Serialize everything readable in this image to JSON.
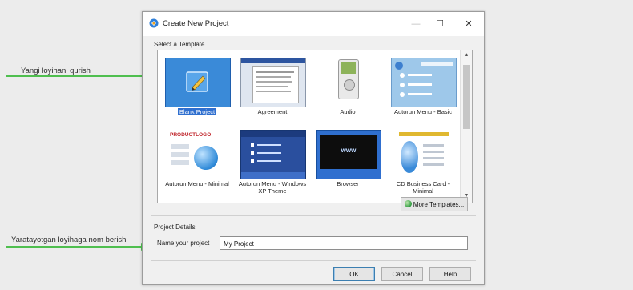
{
  "annotations": {
    "new_project": "Yangi loyihani qurish",
    "name_project": "Yaratayotgan loyihaga nom berish"
  },
  "dialog": {
    "title": "Create New Project",
    "minimize": "—",
    "maximize": "☐",
    "close": "✕",
    "select_template_label": "Select a Template",
    "templates": [
      {
        "label": "Blank Project",
        "selected": true
      },
      {
        "label": "Agreement"
      },
      {
        "label": "Audio"
      },
      {
        "label": "Autorun Menu - Basic"
      },
      {
        "label": "Autorun Menu - Minimal"
      },
      {
        "label": "Autorun Menu - Windows XP Theme"
      },
      {
        "label": "Browser"
      },
      {
        "label": "CD Business Card - Minimal"
      }
    ],
    "thumb_text": {
      "productlogo": "PRODUCTLOGO",
      "www": "www"
    },
    "more_templates_label": "More Templates...",
    "project_details_label": "Project Details",
    "name_label": "Name your project",
    "name_value": "My Project",
    "ok_label": "OK",
    "cancel_label": "Cancel",
    "help_label": "Help"
  },
  "colors": {
    "annotation_green": "#4fbf4f",
    "selection_blue": "#2f6fcf"
  }
}
